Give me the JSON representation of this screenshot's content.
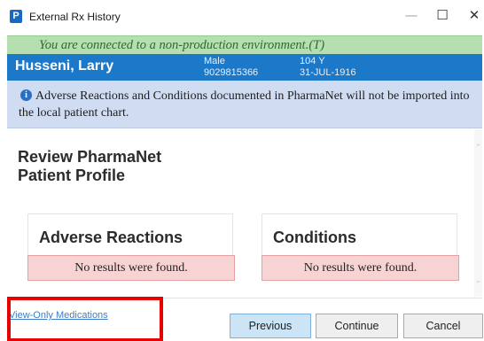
{
  "window": {
    "title": "External Rx History",
    "app_icon_letter": "P",
    "minimize_symbol": "—",
    "maximize_symbol": "☐",
    "close_symbol": "✕"
  },
  "environment": {
    "message": "You are connected to a non-production environment.(T)"
  },
  "patient": {
    "name": "Husseni, Larry",
    "gender": "Male",
    "id": "9029815366",
    "age": "104 Y",
    "dob": "31-JUL-1916"
  },
  "notice": {
    "icon_glyph": "i",
    "text": "Adverse Reactions and Conditions documented in PharmaNet will not be imported into the local patient chart."
  },
  "main": {
    "title": "Review PharmaNet Patient Profile",
    "adverse_reactions": {
      "title": "Adverse Reactions",
      "empty_message": "No results were found."
    },
    "conditions": {
      "title": "Conditions",
      "empty_message": "No results were found."
    }
  },
  "footer": {
    "view_only_link": "View-Only Medications",
    "previous_label": "Previous",
    "continue_label": "Continue",
    "cancel_label": "Cancel"
  },
  "colors": {
    "environment_banner": "#b5dfb0",
    "patient_banner": "#1c78c8",
    "notice_background": "#cfdcf2",
    "no_results_background": "#f8d3d3",
    "highlight_border": "#e60000"
  }
}
